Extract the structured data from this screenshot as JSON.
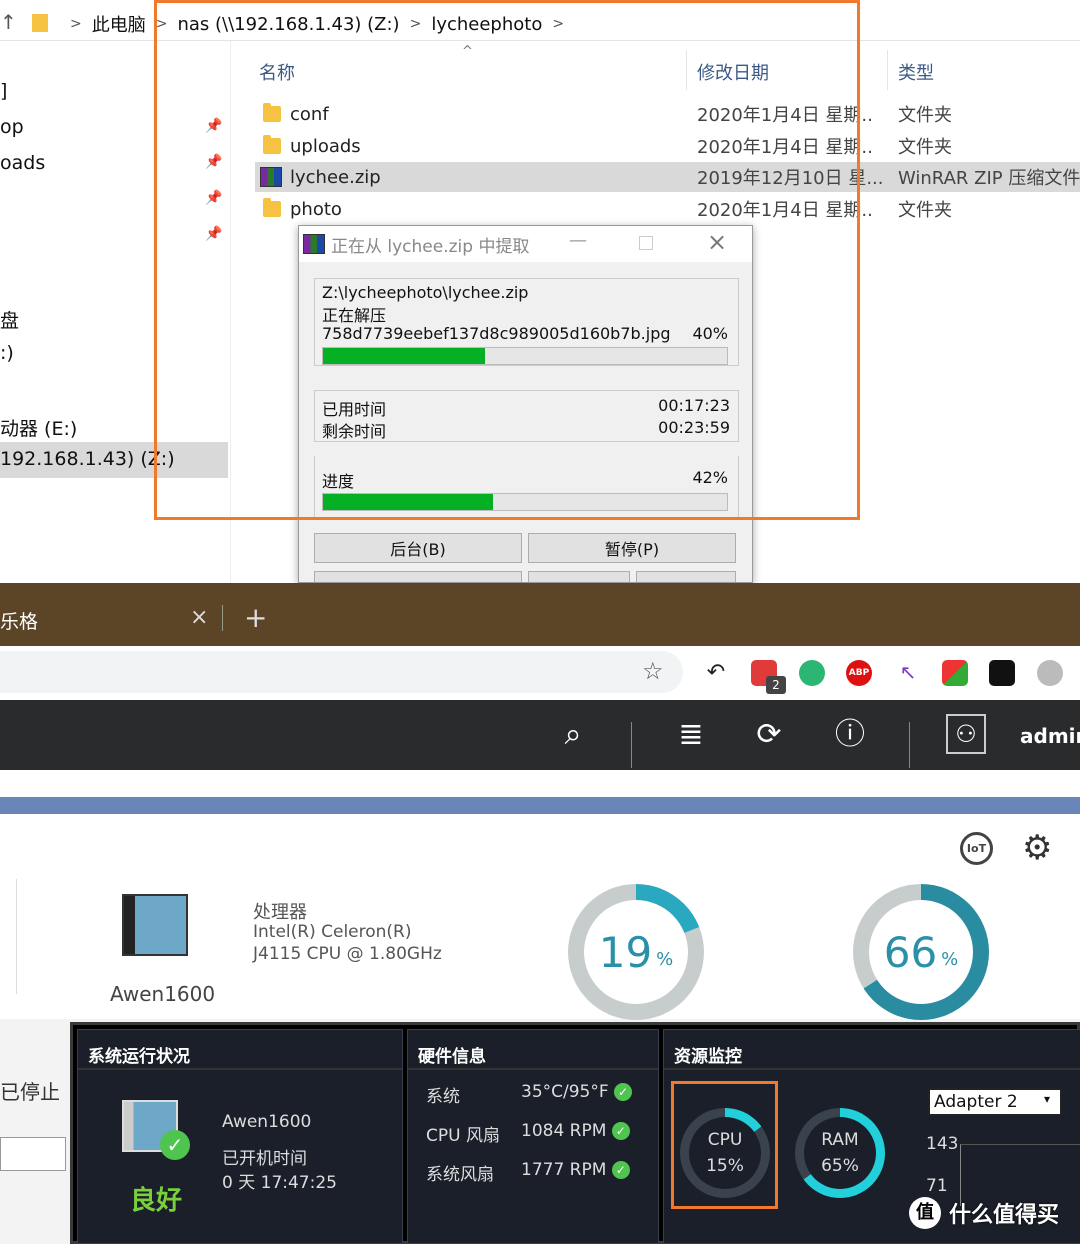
{
  "explorer": {
    "breadcrumb": [
      "此电脑",
      "nas (\\\\192.168.1.43) (Z:)",
      "lycheephoto"
    ],
    "nav_items": [
      "]",
      "op",
      "oads",
      "盘",
      ":)",
      "动器 (E:)",
      "192.168.1.43) (Z:)"
    ],
    "columns": {
      "name": "名称",
      "date": "修改日期",
      "type": "类型"
    },
    "files": [
      {
        "name": "conf",
        "date": "2020年1月4日 星期..",
        "type": "文件夹",
        "icon": "folder-icon"
      },
      {
        "name": "uploads",
        "date": "2020年1月4日 星期..",
        "type": "文件夹",
        "icon": "folder-icon"
      },
      {
        "name": "lychee.zip",
        "date": "2019年12月10日 星...",
        "type": "WinRAR ZIP 压缩文件",
        "icon": "winrar-zip-icon"
      },
      {
        "name": "photo",
        "date": "2020年1月4日 星期..",
        "type": "文件夹",
        "icon": "folder-icon"
      }
    ]
  },
  "winrar": {
    "title": "正在从 lychee.zip 中提取",
    "path": "Z:\\lycheephoto\\lychee.zip",
    "status": "正在解压",
    "current_file": "758d7739eebef137d8c989005d160b7b.jpg",
    "file_percent_label": "40%",
    "file_progress": 0.4,
    "elapsed_label": "已用时间",
    "elapsed": "00:17:23",
    "remaining_label": "剩余时间",
    "remaining": "00:23:59",
    "progress_label": "进度",
    "total_percent_label": "42%",
    "total_progress": 0.42,
    "btn_background": "后台(B)",
    "btn_pause": "暂停(P)"
  },
  "browser": {
    "tab_title": "乐格",
    "badge_count": "2"
  },
  "qnap": {
    "user": "admin",
    "device_name": "Awen1600",
    "cpu_label": "处理器",
    "cpu_model_1": "Intel(R) Celeron(R)",
    "cpu_model_2": "J4115 CPU @ 1.80GHz",
    "donut1_value": "19",
    "donut1_pct": 0.19,
    "donut2_value": "66",
    "donut2_pct": 0.66,
    "pct_sign": "%",
    "stopped_text": "已停止",
    "status_panel": {
      "title": "系统运行状况",
      "name": "Awen1600",
      "uptime_label": "已开机时间",
      "uptime": "0 天 17:47:25",
      "health": "良好"
    },
    "hw_panel": {
      "title": "硬件信息",
      "rows": [
        {
          "label": "系统",
          "value": "35°C/95°F"
        },
        {
          "label": "CPU 风扇",
          "value": "1084 RPM"
        },
        {
          "label": "系统风扇",
          "value": "1777 RPM"
        }
      ]
    },
    "res_panel": {
      "title": "资源监控",
      "cpu_label": "CPU",
      "cpu_value": "15%",
      "cpu_pct": 0.15,
      "ram_label": "RAM",
      "ram_value": "65%",
      "ram_pct": 0.65,
      "adapter": "Adapter 2",
      "y_ticks": [
        "143",
        "71"
      ]
    },
    "watermark": "什么值得买"
  }
}
